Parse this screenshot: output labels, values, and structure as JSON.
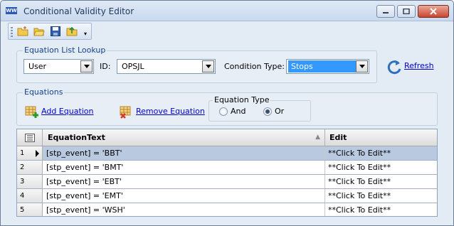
{
  "window": {
    "title": "Conditional Validity Editor",
    "icon_label": "WW"
  },
  "toolbar": {
    "buttons": [
      "new-folder-icon",
      "open-folder-icon",
      "save-icon",
      "export-icon"
    ],
    "overflow": "▾"
  },
  "lookup": {
    "group_label": "Equation List Lookup",
    "user_value": "User",
    "id_label": "ID:",
    "id_value": "OPSJL",
    "condition_type_label": "Condition Type:",
    "condition_type_value": "Stops",
    "refresh_label": "Refresh"
  },
  "equations": {
    "group_label": "Equations",
    "add_label": "Add Equation",
    "remove_label": "Remove Equation",
    "type_group_label": "Equation Type",
    "type_options": [
      "And",
      "Or"
    ],
    "type_selected": "Or"
  },
  "grid": {
    "columns": [
      "EquationText",
      "Edit"
    ],
    "rows": [
      {
        "num": "1",
        "text": "[stp_event] = 'BBT'",
        "edit": "**Click To Edit**"
      },
      {
        "num": "2",
        "text": "[stp_event] = 'BMT'",
        "edit": "**Click To Edit**"
      },
      {
        "num": "3",
        "text": "[stp_event] = 'EBT'",
        "edit": "**Click To Edit**"
      },
      {
        "num": "4",
        "text": "[stp_event] = 'EMT'",
        "edit": "**Click To Edit**"
      },
      {
        "num": "5",
        "text": "[stp_event] = 'WSH'",
        "edit": "**Click To Edit**"
      }
    ],
    "selected_row": 1
  },
  "colors": {
    "accent": "#3399ff",
    "link": "#0000cc",
    "selected_row": "#b9c9e0"
  }
}
